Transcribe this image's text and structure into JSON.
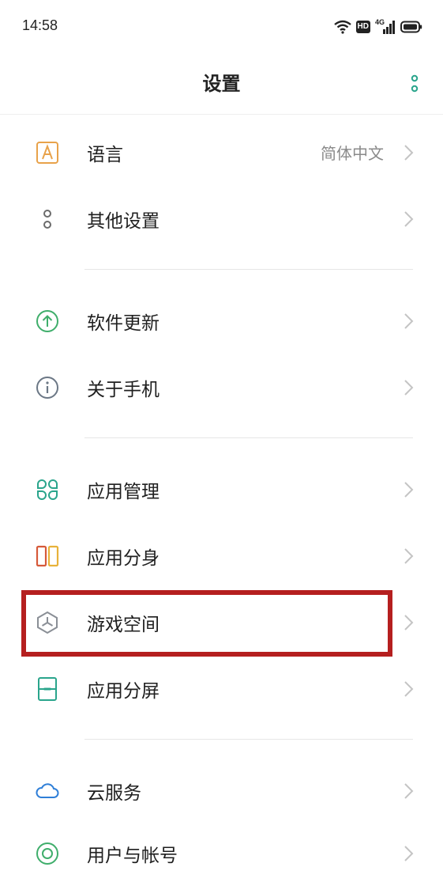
{
  "status_bar": {
    "time": "14:58",
    "hd_badge": "HD",
    "network_type": "4G"
  },
  "header": {
    "title": "设置"
  },
  "sections": [
    {
      "items": [
        {
          "label": "语言",
          "value": "简体中文",
          "icon": "language-icon"
        },
        {
          "label": "其他设置",
          "icon": "other-settings-icon"
        }
      ]
    },
    {
      "items": [
        {
          "label": "软件更新",
          "icon": "software-update-icon"
        },
        {
          "label": "关于手机",
          "icon": "info-icon"
        }
      ]
    },
    {
      "items": [
        {
          "label": "应用管理",
          "icon": "app-management-icon"
        },
        {
          "label": "应用分身",
          "icon": "app-clone-icon"
        },
        {
          "label": "游戏空间",
          "icon": "game-space-icon",
          "highlighted": true
        },
        {
          "label": "应用分屏",
          "icon": "split-screen-icon"
        }
      ]
    },
    {
      "items": [
        {
          "label": "云服务",
          "icon": "cloud-icon"
        },
        {
          "label": "用户与帐号",
          "icon": "user-account-icon"
        }
      ]
    }
  ],
  "colors": {
    "accent": "#2aa58c",
    "highlight_border": "#b51f1f",
    "language_icon": "#e8a24a",
    "update_icon": "#3fae6b",
    "clone_left": "#d65a3a",
    "clone_right": "#e8b23a",
    "cloud_icon": "#2f7fd8"
  }
}
